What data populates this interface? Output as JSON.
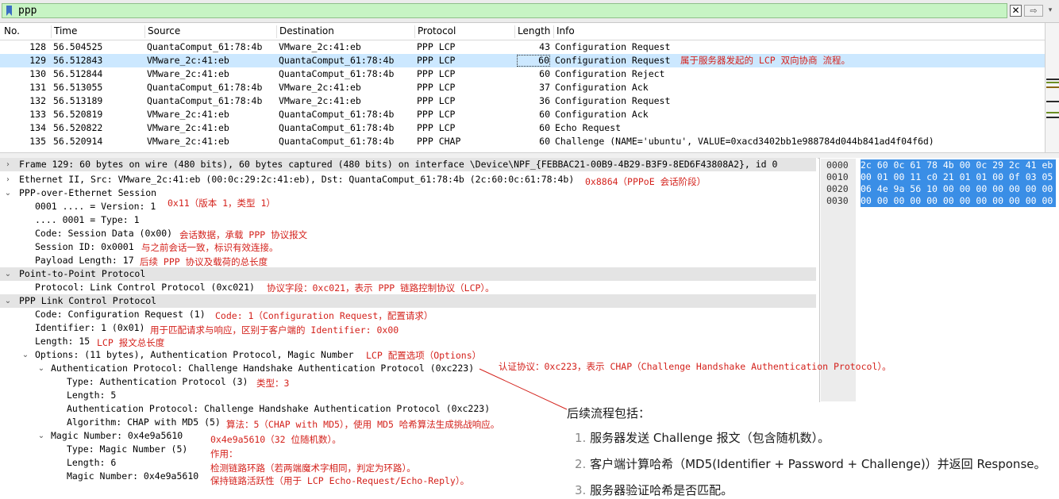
{
  "filter": {
    "value": "ppp"
  },
  "filter_buttons": {
    "clear": "✕",
    "apply": "⇨",
    "dropdown": "▾"
  },
  "columns": {
    "no": "No.",
    "time": "Time",
    "source": "Source",
    "destination": "Destination",
    "protocol": "Protocol",
    "length": "Length",
    "info": "Info"
  },
  "packets": [
    {
      "no": "128",
      "time": "56.504525",
      "src": "QuantaComput_61:78:4b",
      "dst": "VMware_2c:41:eb",
      "proto": "PPP LCP",
      "len": "43",
      "info": "Configuration Request"
    },
    {
      "no": "129",
      "time": "56.512843",
      "src": "VMware_2c:41:eb",
      "dst": "QuantaComput_61:78:4b",
      "proto": "PPP LCP",
      "len": "60",
      "info": "Configuration Request"
    },
    {
      "no": "130",
      "time": "56.512844",
      "src": "VMware_2c:41:eb",
      "dst": "QuantaComput_61:78:4b",
      "proto": "PPP LCP",
      "len": "60",
      "info": "Configuration Reject"
    },
    {
      "no": "131",
      "time": "56.513055",
      "src": "QuantaComput_61:78:4b",
      "dst": "VMware_2c:41:eb",
      "proto": "PPP LCP",
      "len": "37",
      "info": "Configuration Ack"
    },
    {
      "no": "132",
      "time": "56.513189",
      "src": "QuantaComput_61:78:4b",
      "dst": "VMware_2c:41:eb",
      "proto": "PPP LCP",
      "len": "36",
      "info": "Configuration Request"
    },
    {
      "no": "133",
      "time": "56.520819",
      "src": "VMware_2c:41:eb",
      "dst": "QuantaComput_61:78:4b",
      "proto": "PPP LCP",
      "len": "60",
      "info": "Configuration Ack"
    },
    {
      "no": "134",
      "time": "56.520822",
      "src": "VMware_2c:41:eb",
      "dst": "QuantaComput_61:78:4b",
      "proto": "PPP LCP",
      "len": "60",
      "info": "Echo Request"
    },
    {
      "no": "135",
      "time": "56.520914",
      "src": "VMware_2c:41:eb",
      "dst": "QuantaComput_61:78:4b",
      "proto": "PPP CHAP",
      "len": "60",
      "info": "Challenge (NAME='ubuntu', VALUE=0xacd3402bb1e988784d044b841ad4f04f6d)"
    }
  ],
  "selected_row_note": "属于服务器发起的 LCP 双向协商 流程。",
  "details": {
    "frame": "Frame 129: 60 bytes on wire (480 bits), 60 bytes captured (480 bits) on interface \\Device\\NPF_{FEBBAC21-00B9-4B29-B3F9-8ED6F43808A2}, id 0",
    "ethernet": "Ethernet II, Src: VMware_2c:41:eb (00:0c:29:2c:41:eb), Dst: QuantaComput_61:78:4b (2c:60:0c:61:78:4b)",
    "pppoe": "PPP-over-Ethernet Session",
    "version": "0001 .... = Version: 1",
    "type": ".... 0001 = Type: 1",
    "code": "Code: Session Data (0x00)",
    "session_id": "Session ID: 0x0001",
    "payload_length": "Payload Length: 17",
    "ppp": "Point-to-Point Protocol",
    "protocol": "Protocol: Link Control Protocol (0xc021)",
    "lcp": "PPP Link Control Protocol",
    "lcp_code": "Code: Configuration Request (1)",
    "identifier": "Identifier: 1 (0x01)",
    "length": "Length: 15",
    "options": "Options: (11 bytes), Authentication Protocol, Magic Number",
    "auth_proto": "Authentication Protocol: Challenge Handshake Authentication Protocol (0xc223)",
    "auth_type": "Type: Authentication Protocol (3)",
    "auth_len": "Length: 5",
    "auth_proto_inner": "Authentication Protocol: Challenge Handshake Authentication Protocol (0xc223)",
    "algorithm": "Algorithm: CHAP with MD5 (5)",
    "magic": "Magic Number: 0x4e9a5610",
    "magic_type": "Type: Magic Number (5)",
    "magic_len": "Length: 6",
    "magic_val": "Magic Number: 0x4e9a5610"
  },
  "notes": {
    "ethertype": "0x8864（PPPoE 会话阶段）",
    "ver_type": "0x11（版本 1，类型 1）",
    "code": "会话数据，承载 PPP 协议报文",
    "session": "与之前会话一致，标识有效连接。",
    "payload": "后续 PPP 协议及载荷的总长度",
    "protocol": "协议字段：0xc021，表示 PPP 链路控制协议（LCP）。",
    "lcp_code": "Code: 1（Configuration Request，配置请求）",
    "identifier": "用于匹配请求与响应，区别于客户端的 Identifier: 0x00",
    "length": "LCP 报文总长度",
    "options": "LCP 配置选项（Options）",
    "auth": "认证协议：0xc223，表示 CHAP（Challenge Handshake Authentication Protocol）。",
    "auth_type": "类型：3",
    "algorithm": "算法：5（CHAP with MD5），使用 MD5 哈希算法生成挑战响应。",
    "magic1": "0x4e9a5610（32 位随机数）。",
    "magic2": "作用：",
    "magic3": "检测链路环路（若两端魔术字相同，判定为环路）。",
    "magic4": "保持链路活跃性（用于 LCP Echo-Request/Echo-Reply）。"
  },
  "hex": {
    "offsets": [
      "0000",
      "0010",
      "0020",
      "0030"
    ],
    "bytes": [
      "2c 60 0c 61 78 4b 00 0c  29 2c 41 eb",
      "00 01 00 11 c0 21 01 01  00 0f 03 05",
      "06 4e 9a 56 10 00 00 00  00 00 00 00",
      "00 00 00 00 00 00 00 00  00 00 00 00"
    ]
  },
  "callout": {
    "title": "后续流程包括：",
    "items": [
      {
        "n": "1.",
        "text": "服务器发送 Challenge 报文（包含随机数）。"
      },
      {
        "n": "2.",
        "text": "客户端计算哈希（MD5(Identifier + Password + Challenge)）并返回 Response。"
      },
      {
        "n": "3.",
        "text": "服务器验证哈希是否匹配。"
      }
    ]
  },
  "colors": {
    "note_red": "#d4221c",
    "selected_row": "#cce8ff",
    "filter_green": "#c7f4c4",
    "hex_highlight": "#3a8ee6"
  }
}
